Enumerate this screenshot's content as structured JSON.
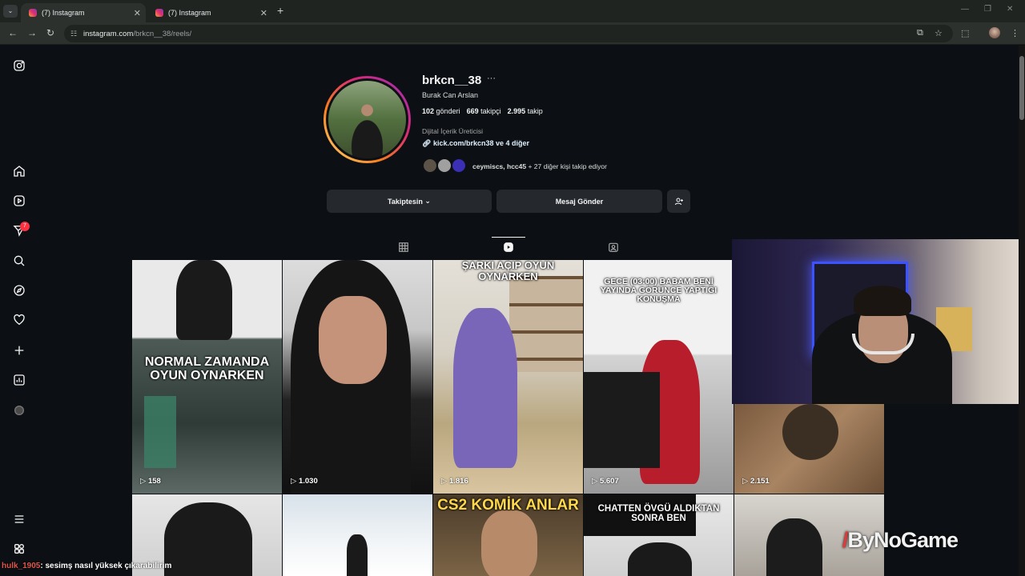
{
  "browser": {
    "tabs": [
      {
        "label": "(7) Instagram",
        "active": true
      },
      {
        "label": "(7) Instagram",
        "active": false
      }
    ],
    "url_host": "instagram.com",
    "url_path": "/brkcn__38/reels/"
  },
  "profile": {
    "username": "brkcn__38",
    "full_name": "Burak Can Arslan",
    "posts_count": "102",
    "posts_label": "gönderi",
    "followers_count": "669",
    "followers_label": "takipçi",
    "following_count": "2.995",
    "following_label": "takip",
    "category": "Dijital İçerik Üreticisi",
    "link": "kick.com/brkcn38 ve 4 diğer",
    "followed_by_names": "ceymiscs, hcc45",
    "followed_by_rest": " + 27 diğer kişi takip ediyor"
  },
  "actions": {
    "following_label": "Takiptesin",
    "message_label": "Mesaj Gönder"
  },
  "sidebar": {
    "notification_count": "7"
  },
  "reels": [
    {
      "caption": "NORMAL ZAMANDA OYUN OYNARKEN",
      "views": "158"
    },
    {
      "caption": "",
      "views": "1.030"
    },
    {
      "caption": "ŞARKI AÇIP OYUN OYNARKEN",
      "views": "1.816"
    },
    {
      "caption": "GECE (03:00) BABAM BENİ YAYINDA GÖRÜNCE YAPTIĞI KONUŞMA",
      "views": "5.607"
    },
    {
      "caption": "",
      "views": "2.151"
    },
    {
      "caption": "",
      "views": ""
    },
    {
      "caption": "",
      "views": ""
    },
    {
      "caption": "CS2 KOMİK ANLAR",
      "views": ""
    },
    {
      "caption": "CHATTEN ÖVGÜ ALDIKTAN SONRA BEN",
      "views": ""
    },
    {
      "caption": "",
      "views": ""
    }
  ],
  "overlay": {
    "chat_user": "hulk_1905",
    "chat_message": ": sesimş nasıl yüksek çıkarabilirim",
    "watermark": "ByNoGame"
  }
}
